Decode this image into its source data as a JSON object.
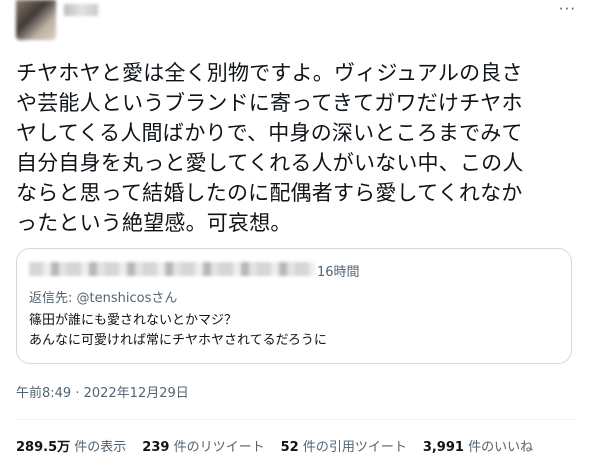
{
  "tweet": {
    "more_label": "···",
    "text": "チヤホヤと愛は全く別物ですよ。ヴィジュアルの良さ\nや芸能人というブランドに寄ってきてガワだけチヤホ\nヤしてくる人間ばかりで、中身の深いところまでみて\n自分自身を丸っと愛してくれる人がいない中、この人\nならと思って結婚したのに配偶者すら愛してくれなか\nったという絶望感。可哀想。",
    "timestamp": "午前8:49 · 2022年12月29日"
  },
  "quote": {
    "time": "16時間",
    "reply_prefix": "返信先: ",
    "reply_handle": "@tenshicosさん",
    "line1": "篠田が誰にも愛されないとかマジ？",
    "line2": "あんなに可愛ければ常にチヤホヤされてるだろうに"
  },
  "stats": {
    "views_count": "289.5万",
    "views_label": "件の表示",
    "retweets_count": "239",
    "retweets_label": "件のリツイート",
    "quotes_count": "52",
    "quotes_label": "件の引用ツイート",
    "likes_count": "3,991",
    "likes_label": "件のいいね"
  }
}
